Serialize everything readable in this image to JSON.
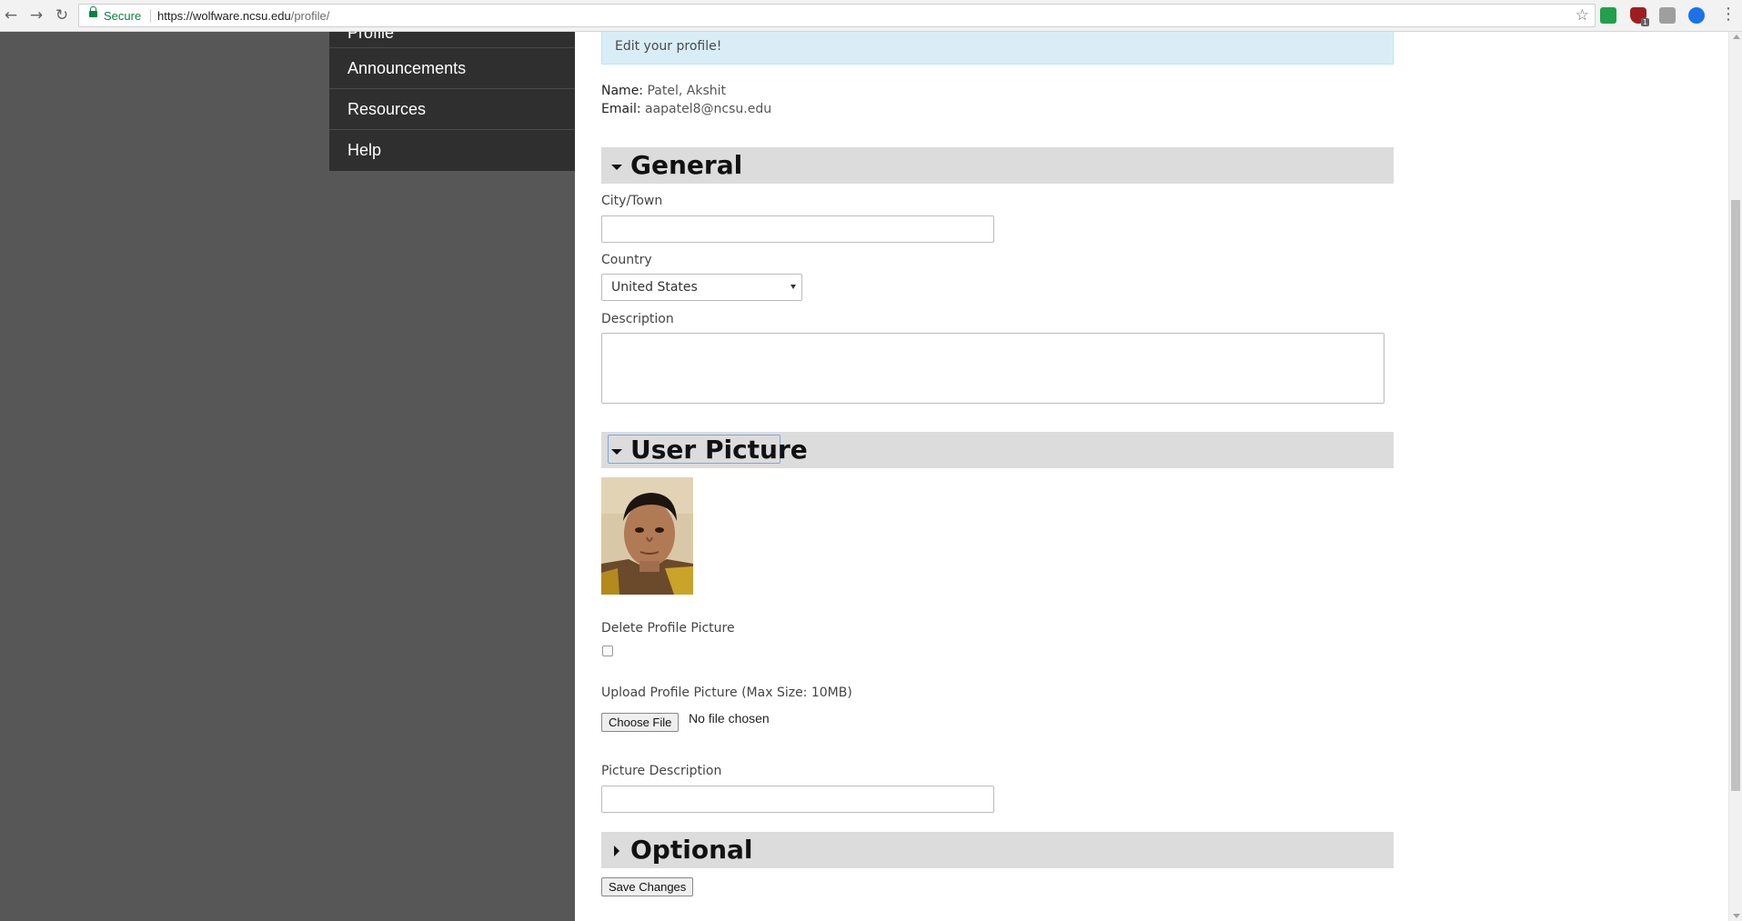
{
  "browser": {
    "secure_label": "Secure",
    "url_host": "https://wolfware.ncsu.edu",
    "url_path": "/profile/"
  },
  "sidebar": {
    "partial_item": "Profile",
    "items": [
      {
        "label": "Announcements"
      },
      {
        "label": "Resources"
      },
      {
        "label": "Help"
      }
    ]
  },
  "alert": {
    "text": "Edit your profile!"
  },
  "user": {
    "name_label": "Name:",
    "name": "Patel, Akshit",
    "email_label": "Email:",
    "email": "aapatel8@ncsu.edu"
  },
  "general": {
    "title": "General",
    "city_label": "City/Town",
    "city_value": "",
    "country_label": "Country",
    "country_value": "United States",
    "description_label": "Description",
    "description_value": ""
  },
  "picture": {
    "title": "User Picture",
    "delete_label": "Delete Profile Picture",
    "upload_label": "Upload Profile Picture (Max Size: 10MB)",
    "choose_button": "Choose File",
    "no_file": "No file chosen",
    "desc_label": "Picture Description",
    "desc_value": ""
  },
  "optional": {
    "title": "Optional"
  },
  "actions": {
    "save_label": "Save Changes"
  },
  "colors": {
    "sidebar_bg": "#2f2f2f",
    "page_left_bg": "#575757",
    "alert_bg": "#d9edf7",
    "section_bg": "#dcdcdc",
    "secure_green": "#0b8043"
  }
}
